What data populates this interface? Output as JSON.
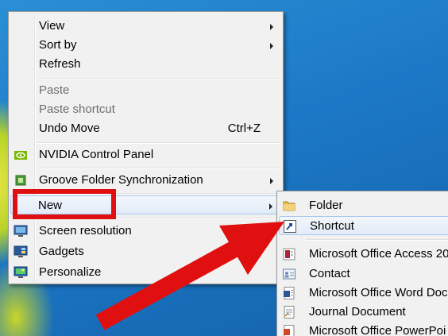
{
  "context_menu": {
    "items": [
      {
        "label": "View",
        "submenu": true
      },
      {
        "label": "Sort by",
        "submenu": true
      },
      {
        "label": "Refresh"
      },
      {
        "label": "Paste",
        "disabled": true
      },
      {
        "label": "Paste shortcut",
        "disabled": true
      },
      {
        "label": "Undo Move",
        "shortcut": "Ctrl+Z"
      },
      {
        "label": "NVIDIA Control Panel",
        "icon": "nvidia-icon"
      },
      {
        "label": "Groove Folder Synchronization",
        "icon": "groove-icon",
        "submenu": true
      },
      {
        "label": "New",
        "submenu": true,
        "highlighted": true
      },
      {
        "label": "Screen resolution",
        "icon": "display-icon"
      },
      {
        "label": "Gadgets",
        "icon": "gadgets-icon"
      },
      {
        "label": "Personalize",
        "icon": "personalize-icon"
      }
    ]
  },
  "new_submenu": {
    "items": [
      {
        "label": "Folder",
        "icon": "folder-icon"
      },
      {
        "label": "Shortcut",
        "icon": "shortcut-icon",
        "highlighted": true
      },
      {
        "label": "Microsoft Office Access 20",
        "icon": "access-icon"
      },
      {
        "label": "Contact",
        "icon": "contact-icon"
      },
      {
        "label": "Microsoft Office Word Doc",
        "icon": "word-icon"
      },
      {
        "label": "Journal Document",
        "icon": "journal-icon"
      },
      {
        "label": "Microsoft Office PowerPoi",
        "icon": "powerpoint-icon"
      }
    ]
  },
  "annotations": {
    "highlight_color": "#e01010",
    "highlight_target": "New",
    "arrow_target": "Shortcut"
  }
}
